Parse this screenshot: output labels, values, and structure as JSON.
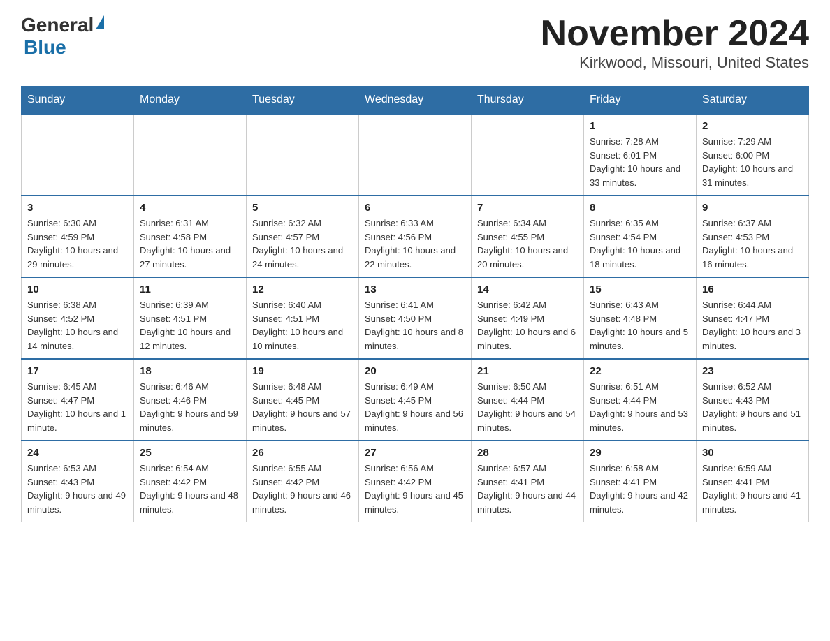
{
  "header": {
    "logo_general": "General",
    "logo_blue": "Blue",
    "title": "November 2024",
    "subtitle": "Kirkwood, Missouri, United States"
  },
  "days_of_week": [
    "Sunday",
    "Monday",
    "Tuesday",
    "Wednesday",
    "Thursday",
    "Friday",
    "Saturday"
  ],
  "weeks": [
    {
      "days": [
        {
          "num": "",
          "info": ""
        },
        {
          "num": "",
          "info": ""
        },
        {
          "num": "",
          "info": ""
        },
        {
          "num": "",
          "info": ""
        },
        {
          "num": "",
          "info": ""
        },
        {
          "num": "1",
          "info": "Sunrise: 7:28 AM\nSunset: 6:01 PM\nDaylight: 10 hours and 33 minutes."
        },
        {
          "num": "2",
          "info": "Sunrise: 7:29 AM\nSunset: 6:00 PM\nDaylight: 10 hours and 31 minutes."
        }
      ]
    },
    {
      "days": [
        {
          "num": "3",
          "info": "Sunrise: 6:30 AM\nSunset: 4:59 PM\nDaylight: 10 hours and 29 minutes."
        },
        {
          "num": "4",
          "info": "Sunrise: 6:31 AM\nSunset: 4:58 PM\nDaylight: 10 hours and 27 minutes."
        },
        {
          "num": "5",
          "info": "Sunrise: 6:32 AM\nSunset: 4:57 PM\nDaylight: 10 hours and 24 minutes."
        },
        {
          "num": "6",
          "info": "Sunrise: 6:33 AM\nSunset: 4:56 PM\nDaylight: 10 hours and 22 minutes."
        },
        {
          "num": "7",
          "info": "Sunrise: 6:34 AM\nSunset: 4:55 PM\nDaylight: 10 hours and 20 minutes."
        },
        {
          "num": "8",
          "info": "Sunrise: 6:35 AM\nSunset: 4:54 PM\nDaylight: 10 hours and 18 minutes."
        },
        {
          "num": "9",
          "info": "Sunrise: 6:37 AM\nSunset: 4:53 PM\nDaylight: 10 hours and 16 minutes."
        }
      ]
    },
    {
      "days": [
        {
          "num": "10",
          "info": "Sunrise: 6:38 AM\nSunset: 4:52 PM\nDaylight: 10 hours and 14 minutes."
        },
        {
          "num": "11",
          "info": "Sunrise: 6:39 AM\nSunset: 4:51 PM\nDaylight: 10 hours and 12 minutes."
        },
        {
          "num": "12",
          "info": "Sunrise: 6:40 AM\nSunset: 4:51 PM\nDaylight: 10 hours and 10 minutes."
        },
        {
          "num": "13",
          "info": "Sunrise: 6:41 AM\nSunset: 4:50 PM\nDaylight: 10 hours and 8 minutes."
        },
        {
          "num": "14",
          "info": "Sunrise: 6:42 AM\nSunset: 4:49 PM\nDaylight: 10 hours and 6 minutes."
        },
        {
          "num": "15",
          "info": "Sunrise: 6:43 AM\nSunset: 4:48 PM\nDaylight: 10 hours and 5 minutes."
        },
        {
          "num": "16",
          "info": "Sunrise: 6:44 AM\nSunset: 4:47 PM\nDaylight: 10 hours and 3 minutes."
        }
      ]
    },
    {
      "days": [
        {
          "num": "17",
          "info": "Sunrise: 6:45 AM\nSunset: 4:47 PM\nDaylight: 10 hours and 1 minute."
        },
        {
          "num": "18",
          "info": "Sunrise: 6:46 AM\nSunset: 4:46 PM\nDaylight: 9 hours and 59 minutes."
        },
        {
          "num": "19",
          "info": "Sunrise: 6:48 AM\nSunset: 4:45 PM\nDaylight: 9 hours and 57 minutes."
        },
        {
          "num": "20",
          "info": "Sunrise: 6:49 AM\nSunset: 4:45 PM\nDaylight: 9 hours and 56 minutes."
        },
        {
          "num": "21",
          "info": "Sunrise: 6:50 AM\nSunset: 4:44 PM\nDaylight: 9 hours and 54 minutes."
        },
        {
          "num": "22",
          "info": "Sunrise: 6:51 AM\nSunset: 4:44 PM\nDaylight: 9 hours and 53 minutes."
        },
        {
          "num": "23",
          "info": "Sunrise: 6:52 AM\nSunset: 4:43 PM\nDaylight: 9 hours and 51 minutes."
        }
      ]
    },
    {
      "days": [
        {
          "num": "24",
          "info": "Sunrise: 6:53 AM\nSunset: 4:43 PM\nDaylight: 9 hours and 49 minutes."
        },
        {
          "num": "25",
          "info": "Sunrise: 6:54 AM\nSunset: 4:42 PM\nDaylight: 9 hours and 48 minutes."
        },
        {
          "num": "26",
          "info": "Sunrise: 6:55 AM\nSunset: 4:42 PM\nDaylight: 9 hours and 46 minutes."
        },
        {
          "num": "27",
          "info": "Sunrise: 6:56 AM\nSunset: 4:42 PM\nDaylight: 9 hours and 45 minutes."
        },
        {
          "num": "28",
          "info": "Sunrise: 6:57 AM\nSunset: 4:41 PM\nDaylight: 9 hours and 44 minutes."
        },
        {
          "num": "29",
          "info": "Sunrise: 6:58 AM\nSunset: 4:41 PM\nDaylight: 9 hours and 42 minutes."
        },
        {
          "num": "30",
          "info": "Sunrise: 6:59 AM\nSunset: 4:41 PM\nDaylight: 9 hours and 41 minutes."
        }
      ]
    }
  ]
}
